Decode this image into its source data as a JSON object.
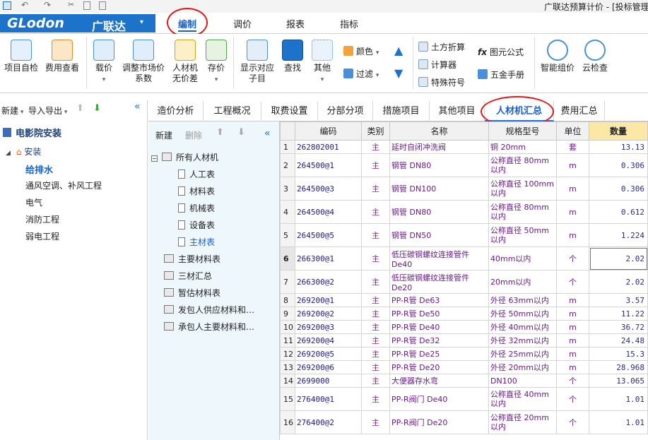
{
  "titlebar": {
    "title": "广联达预算计价 - [投标管理"
  },
  "logo": {
    "brand": "GLodon",
    "cn": "广联达",
    "arrow": "▾"
  },
  "menu": [
    {
      "label": "编制"
    },
    {
      "label": "调价"
    },
    {
      "label": "报表"
    },
    {
      "label": "指标"
    }
  ],
  "ribbon": {
    "project_check": "项目自检",
    "fee_check": "费用查看",
    "rate": "载价",
    "adjust_market_1": "调整市场价",
    "adjust_market_2": "系数",
    "labor_no_diff_1": "人材机",
    "labor_no_diff_2": "无价差",
    "save_price": "存价",
    "show_sub_1": "显示对应",
    "show_sub_2": "子目",
    "search": "查找",
    "other": "其他",
    "color": "颜色",
    "filter": "过滤",
    "earth": "土方折算",
    "calculator": "计算器",
    "special": "特殊符号",
    "formula": "图元公式",
    "hardware": "五金手册",
    "smart_price": "智能组价",
    "cloud_check": "云检查"
  },
  "left": {
    "new": "新建",
    "import_export": "导入导出",
    "project": "电影院安装",
    "install": "安装",
    "items": [
      "给排水",
      "通风空调、补风工程",
      "电气",
      "消防工程",
      "弱电工程"
    ],
    "selected": "给排水"
  },
  "tabs": [
    "造价分析",
    "工程概况",
    "取费设置",
    "分部分项",
    "措施项目",
    "其他项目",
    "人材机汇总",
    "费用汇总"
  ],
  "active_tab": "人材机汇总",
  "mid": {
    "new": "新建",
    "delete": "删除",
    "all": "所有人材机",
    "children": [
      "人工表",
      "材料表",
      "机械表",
      "设备表",
      "主材表"
    ],
    "selected_child": "主材表",
    "others": [
      "主要材料表",
      "三材汇总",
      "暂估材料表",
      "发包人供应材料和…",
      "承包人主要材料和…"
    ]
  },
  "grid": {
    "headers": [
      "",
      "编码",
      "类别",
      "名称",
      "规格型号",
      "单位",
      "数量"
    ],
    "rows": [
      {
        "n": "1",
        "code": "262802001",
        "cat": "主",
        "name": "延时自闭冲洗阀",
        "spec": "铜 20mm",
        "unit": "套",
        "qty": "13.13"
      },
      {
        "n": "2",
        "code": "264500@1",
        "cat": "主",
        "name": "钢管 DN80",
        "spec": "公称直径 80mm以内",
        "unit": "m",
        "qty": "0.306"
      },
      {
        "n": "3",
        "code": "264500@3",
        "cat": "主",
        "name": "钢管 DN100",
        "spec": "公称直径 100mm以内",
        "unit": "m",
        "qty": "0.306"
      },
      {
        "n": "4",
        "code": "264500@4",
        "cat": "主",
        "name": "钢管 DN80",
        "spec": "公称直径 80mm以内",
        "unit": "m",
        "qty": "0.612"
      },
      {
        "n": "5",
        "code": "264500@5",
        "cat": "主",
        "name": "钢管 DN50",
        "spec": "公称直径 50mm以内",
        "unit": "m",
        "qty": "1.224"
      },
      {
        "n": "6",
        "code": "266300@1",
        "cat": "主",
        "name": "低压碳钢螺纹连接管件 De40",
        "spec": "40mm以内",
        "unit": "个",
        "qty": "2.02"
      },
      {
        "n": "7",
        "code": "266300@2",
        "cat": "主",
        "name": "低压碳钢螺纹连接管件 De20",
        "spec": "20mm以内",
        "unit": "个",
        "qty": "2.02"
      },
      {
        "n": "8",
        "code": "269200@1",
        "cat": "主",
        "name": "PP-R管 De63",
        "spec": "外径 63mm以内",
        "unit": "m",
        "qty": "3.57"
      },
      {
        "n": "9",
        "code": "269200@2",
        "cat": "主",
        "name": "PP-R管 De50",
        "spec": "外径 50mm以内",
        "unit": "m",
        "qty": "11.22"
      },
      {
        "n": "10",
        "code": "269200@3",
        "cat": "主",
        "name": "PP-R管 De40",
        "spec": "外径 40mm以内",
        "unit": "m",
        "qty": "36.72"
      },
      {
        "n": "11",
        "code": "269200@4",
        "cat": "主",
        "name": "PP-R管 De32",
        "spec": "外径 32mm以内",
        "unit": "m",
        "qty": "24.48"
      },
      {
        "n": "12",
        "code": "269200@5",
        "cat": "主",
        "name": "PP-R管 De25",
        "spec": "外径 25mm以内",
        "unit": "m",
        "qty": "15.3"
      },
      {
        "n": "13",
        "code": "269200@6",
        "cat": "主",
        "name": "PP-R管 De20",
        "spec": "外径 20mm以内",
        "unit": "m",
        "qty": "28.968"
      },
      {
        "n": "14",
        "code": "2699000",
        "cat": "主",
        "name": "大便器存水弯",
        "spec": "DN100",
        "unit": "个",
        "qty": "13.065"
      },
      {
        "n": "15",
        "code": "276400@1",
        "cat": "主",
        "name": "PP-R阀门 De40",
        "spec": "公称直径 40mm以内",
        "unit": "个",
        "qty": "1.01"
      },
      {
        "n": "16",
        "code": "276400@2",
        "cat": "主",
        "name": "PP-R阀门 De20",
        "spec": "公称直径 20mm以内",
        "unit": "个",
        "qty": "1.01"
      }
    ],
    "selected_row": "6"
  },
  "colors": {
    "brand_blue": "#1d72c9",
    "active_tab": "#1a5fc8",
    "highlight_circle": "#e01818",
    "qty_header": "#fbe7a6"
  }
}
